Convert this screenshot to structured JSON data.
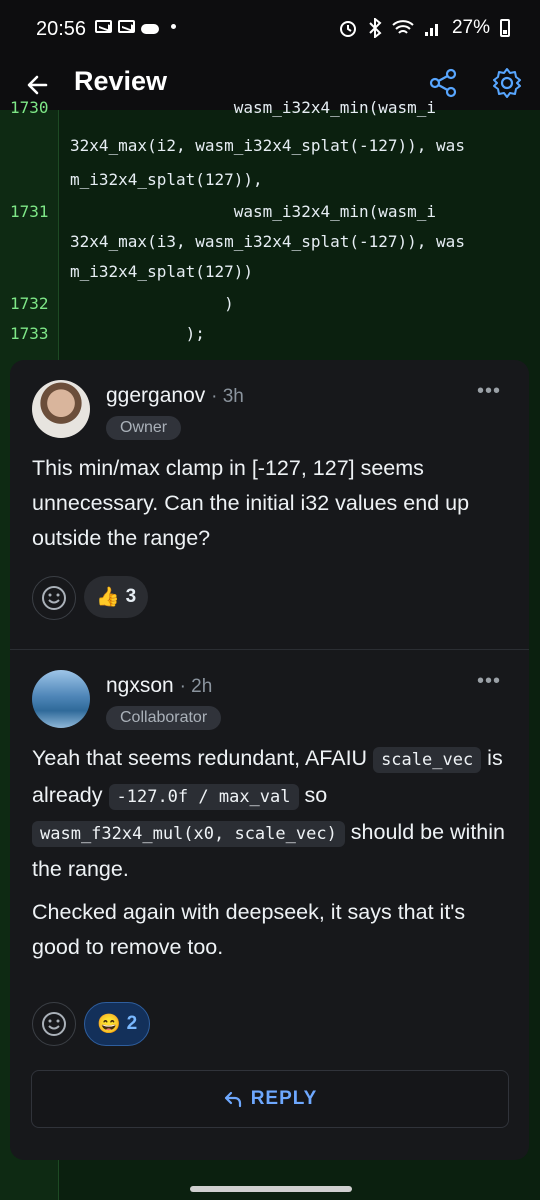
{
  "status": {
    "time": "20:56",
    "battery": "27%"
  },
  "header": {
    "title": "Review"
  },
  "code": {
    "lines": [
      {
        "num": "1730",
        "text": "                 wasm_i32x4_min(wasm_i"
      },
      {
        "num": "",
        "text": "32x4_max(i2, wasm_i32x4_splat(-127)), was"
      },
      {
        "num": "",
        "text": "m_i32x4_splat(127)),"
      },
      {
        "num": "1731",
        "text": "                 wasm_i32x4_min(wasm_i"
      },
      {
        "num": "",
        "text": "32x4_max(i3, wasm_i32x4_splat(-127)), was"
      },
      {
        "num": "",
        "text": "m_i32x4_splat(127))"
      },
      {
        "num": "1732",
        "text": "                )"
      },
      {
        "num": "1733",
        "text": "            );"
      }
    ]
  },
  "comments": [
    {
      "author": "ggerganov",
      "age": "· 3h",
      "role": "Owner",
      "body": "This min/max clamp in [-127, 127] seems unnecessary. Can the initial i32 values end up outside the range?",
      "reaction_emoji": "👍",
      "reaction_count": "3"
    },
    {
      "author": "ngxson",
      "age": "· 2h",
      "role": "Collaborator",
      "body_p1_a": "Yeah that seems redundant, AFAIU",
      "code1": "scale_vec",
      "body_p1_b": "is already",
      "code2": "-127.0f / max_val",
      "body_p1_c": "so",
      "code3": "wasm_f32x4_mul(x0, scale_vec)",
      "body_p1_d": "should be within the range.",
      "body_p2": "Checked again with deepseek, it says that it's good to remove too.",
      "reaction_emoji": "😄",
      "reaction_count": "2"
    }
  ],
  "reply_label": "REPLY",
  "more_label": "•••"
}
